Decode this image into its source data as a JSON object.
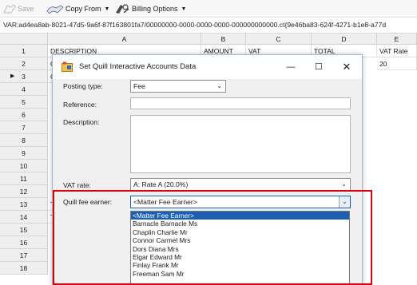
{
  "toolbar": {
    "save_label": "Save",
    "copy_from_label": "Copy From",
    "billing_options_label": "Billing Options"
  },
  "path_text": "VAR:ad4ea8ab-8021-47d5-9a6f-87f163801fa7/00000000-0000-0000-0000-000000000000.ct{9e46ba83-624f-4271-b1e8-a77d",
  "grid": {
    "columns": [
      "A",
      "B",
      "C",
      "D",
      "E"
    ],
    "row_numbers": [
      "1",
      "2",
      "3",
      "4",
      "5",
      "6",
      "7",
      "8",
      "9",
      "10",
      "11",
      "12",
      "13",
      "14",
      "15",
      "16",
      "17",
      "18"
    ],
    "current_row_marker": "▶",
    "header_row": {
      "a": "DESCRIPTION",
      "b": "AMOUNT",
      "c": "VAT",
      "d": "TOTAL",
      "e": "VAT Rate"
    },
    "row2_a": "C",
    "row2_e": "20",
    "row3_a": "C",
    "row12_a": "T",
    "row13_a": "T"
  },
  "dialog": {
    "title": "Set Quill Interactive Accounts Data",
    "posting_type_label": "Posting type:",
    "posting_type_value": "Fee",
    "reference_label": "Reference:",
    "reference_value": "",
    "description_label": "Description:",
    "description_value": "",
    "vat_rate_label": "VAT rate:",
    "vat_rate_value": "A: Rate A (20.0%)",
    "fee_earner_label": "Quill fee earner:",
    "fee_earner_value": "<Matter Fee Earner>",
    "fee_earner_options": [
      "<Matter Fee Earner>",
      "Barnacle Barnacle Ms",
      "Chaplin Charlie Mr",
      "Connor Carmel Mrs",
      "Dors Diana Mrs",
      "Elgar Edward Mr",
      "Finlay Frank Mr",
      "Freeman Sam Mr"
    ]
  },
  "colors": {
    "selection": "#1a5fb4",
    "highlight_box": "#e0000b"
  },
  "icons": {
    "save": "floppy-disk-icon",
    "copy_from": "copy-icon",
    "billing_options": "billing-icon",
    "app": "quill-app-icon"
  }
}
